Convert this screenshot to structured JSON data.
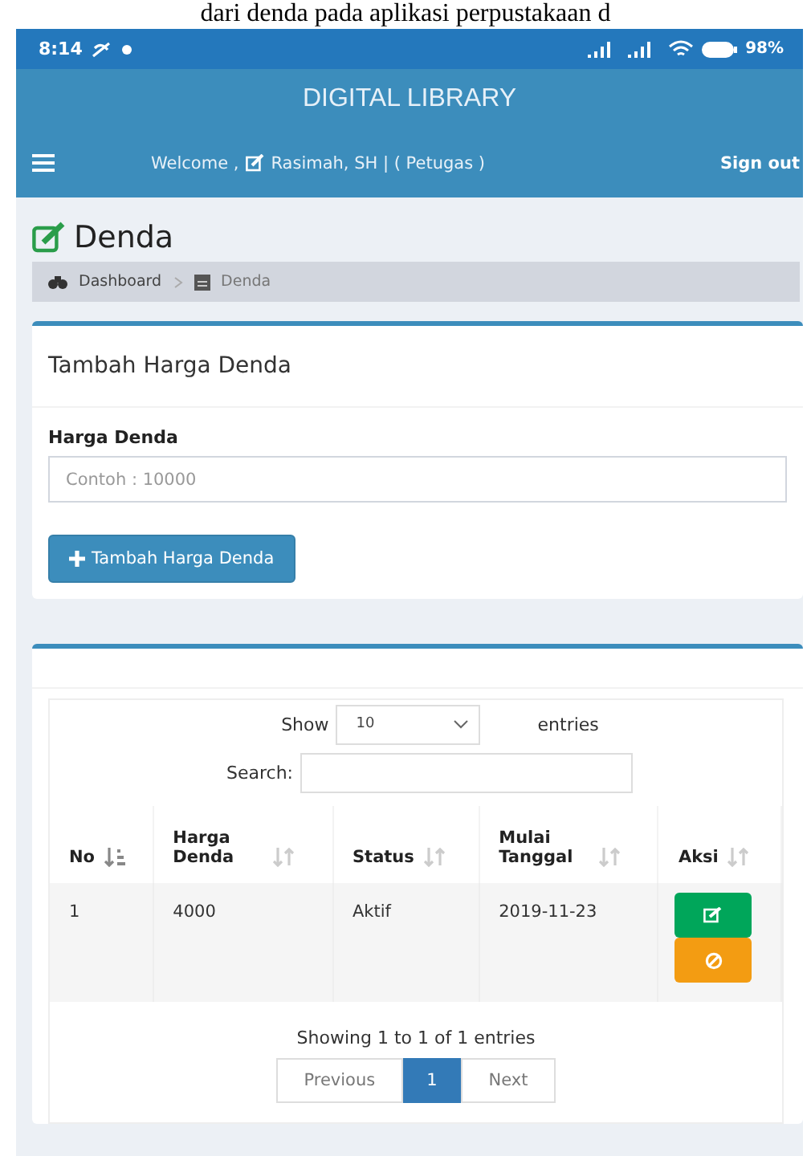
{
  "caption": "dari denda pada aplikasi perpustakaan d",
  "status_bar": {
    "time": "8:14",
    "battery": "98%"
  },
  "app_title": "DIGITAL LIBRARY",
  "navbar": {
    "welcome_prefix": "Welcome ,",
    "welcome_user": "Rasimah, SH | ( Petugas )",
    "sign_out": "Sign out"
  },
  "page_title": "Denda",
  "breadcrumb": [
    "Dashboard",
    "Denda"
  ],
  "form_card": {
    "title": "Tambah Harga Denda",
    "field_label": "Harga Denda",
    "placeholder": "Contoh : 10000",
    "button": "Tambah Harga Denda"
  },
  "table_card": {
    "show_label": "Show",
    "page_size": "10",
    "entries_label": "entries",
    "search_label": "Search:",
    "columns": [
      {
        "label": "No",
        "sorted": true
      },
      {
        "label": "Harga Denda",
        "sorted": false
      },
      {
        "label": "Status",
        "sorted": false
      },
      {
        "label": "Mulai Tanggal",
        "sorted": false
      },
      {
        "label": "Aksi",
        "sorted": false
      }
    ],
    "rows": [
      {
        "cells": [
          "1",
          "4000",
          "Aktif",
          "2019-11-23"
        ]
      }
    ],
    "info": "Showing 1 to 1 of 1 entries",
    "pages": [
      {
        "label": "Previous",
        "selected": false
      },
      {
        "label": "1",
        "selected": true
      },
      {
        "label": "Next",
        "selected": false
      }
    ]
  }
}
